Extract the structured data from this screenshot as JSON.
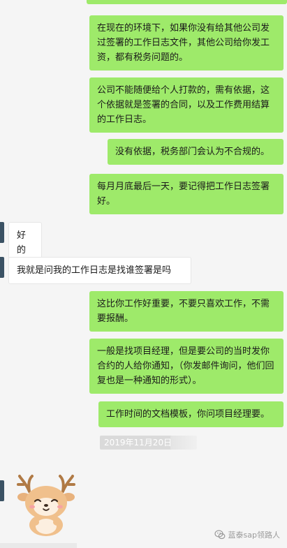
{
  "messages": [
    {
      "side": "right",
      "text": "在现在的环境下，如果你没有给其他公司发过签署的工作日志文件，其他公司给你发工资，都有税务问题的。"
    },
    {
      "side": "right",
      "text": "公司不能随便给个人打款的，需有依据，这个依据就是签署的合同，以及工作费用结算的工作日志。"
    },
    {
      "side": "right",
      "text": "没有依据，税务部门会认为不合规的。"
    },
    {
      "side": "right",
      "text": "每月月底最后一天，要记得把工作日志签署好。"
    },
    {
      "side": "left",
      "text": "好的"
    },
    {
      "side": "left",
      "text": "我就是问我的工作日志是找谁签署是吗"
    },
    {
      "side": "right",
      "text": "这比你工作好重要，不要只喜欢工作，不需要报酬。"
    },
    {
      "side": "right",
      "text": "一般是找项目经理，但是要公司的当时发你合约的人给你通知，（你发邮件询问，他们回复也是一种通知的形式）。"
    },
    {
      "side": "right",
      "text": "工作时间的文档模板，你问项目经理要。"
    }
  ],
  "timestamp": "2019年11月20日",
  "watermark": "蓝泰sap领路人",
  "colors": {
    "right_bubble": "#9eea6a",
    "left_bubble": "#ffffff",
    "background": "#f5f5f5"
  },
  "icons": {
    "sticker": "cartoon-deer-sticker-icon",
    "watermark": "wechat-logo-icon"
  }
}
